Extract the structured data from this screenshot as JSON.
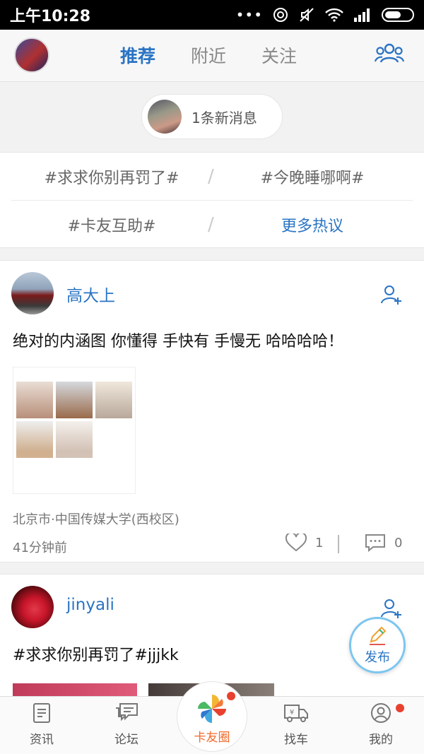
{
  "status_bar": {
    "time": "上午10:28"
  },
  "top_nav": {
    "tabs": [
      {
        "label": "推荐",
        "active": true
      },
      {
        "label": "附近",
        "active": false
      },
      {
        "label": "关注",
        "active": false
      }
    ]
  },
  "new_message": {
    "text": "1条新消息"
  },
  "hot_topics": {
    "items": [
      "#求求你别再罚了#",
      "#今晚睡哪啊#",
      "#卡友互助#"
    ],
    "more_label": "更多热议",
    "separator": "/"
  },
  "posts": [
    {
      "author": "高大上",
      "text": "绝对的内涵图 你懂得 手快有 手慢无 哈哈哈哈！",
      "location": "北京市·中国传媒大学(西校区)",
      "time": "41分钟前",
      "likes": "1",
      "comments": "0"
    },
    {
      "author": "jinyali",
      "text": "#求求你别再罚了#jjjkk"
    }
  ],
  "publish_button": {
    "label": "发布"
  },
  "bottom_nav": {
    "items": [
      {
        "label": "资讯"
      },
      {
        "label": "论坛"
      },
      {
        "label": "卡友圈",
        "active": true
      },
      {
        "label": "找车"
      },
      {
        "label": "我的"
      }
    ]
  },
  "colors": {
    "accent": "#2a74c4",
    "active_tab_bottom": "#f26a2a",
    "notification_dot": "#e8412f"
  }
}
